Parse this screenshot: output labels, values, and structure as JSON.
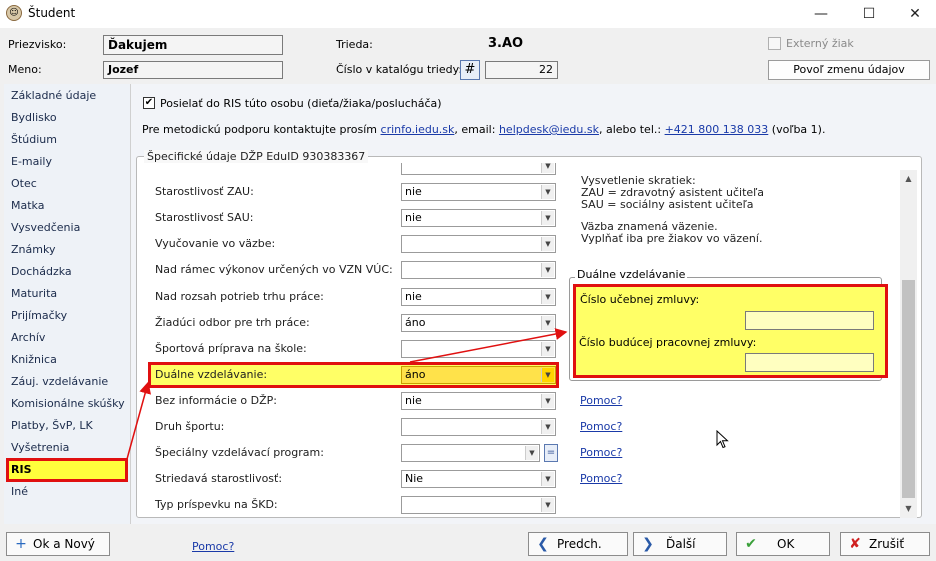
{
  "window": {
    "title": "Študent",
    "controls": [
      "minimize-icon",
      "maximize-icon",
      "close-icon"
    ]
  },
  "header": {
    "surname_label": "Priezvisko:",
    "surname_value": "Ďakujem",
    "name_label": "Meno:",
    "name_value": "Jozef",
    "class_label": "Trieda:",
    "class_value": "3.AO",
    "catalog_label": "Číslo v katalógu triedy:",
    "catalog_hash": "#",
    "catalog_value": "22",
    "external_label": "Externý žiak",
    "allow_change_button": "Povoľ zmenu údajov"
  },
  "sidebar": {
    "items": [
      {
        "label": "Základné údaje"
      },
      {
        "label": "Bydlisko"
      },
      {
        "label": "Štúdium"
      },
      {
        "label": "E-maily"
      },
      {
        "label": "Otec"
      },
      {
        "label": "Matka"
      },
      {
        "label": "Vysvedčenia"
      },
      {
        "label": "Známky"
      },
      {
        "label": "Dochádzka"
      },
      {
        "label": "Maturita"
      },
      {
        "label": "Prijímačky"
      },
      {
        "label": "Archív"
      },
      {
        "label": "Knižnica"
      },
      {
        "label": "Záuj. vzdelávanie"
      },
      {
        "label": "Komisionálne skúšky"
      },
      {
        "label": "Platby, ŠvP, LK"
      },
      {
        "label": "Vyšetrenia"
      },
      {
        "label": "RIS"
      },
      {
        "label": "Iné"
      }
    ]
  },
  "main": {
    "send_to_ris_label": "Posielať do RIS túto osobu (dieťa/žiaka/poslucháča)",
    "support_text_1": "Pre metodickú podporu kontaktujte prosím",
    "support_link_1": "crinfo.iedu.sk",
    "support_text_2": ", email:",
    "support_link_2": "helpdesk@iedu.sk",
    "support_text_3": ", alebo tel.:",
    "support_link_3": "+421 800 138 033",
    "support_text_4": "(voľba 1).",
    "group_title": "Špecifické údaje DŽP EduID 930383367",
    "fields": [
      {
        "label": "Starostlivosť ZAU:",
        "value": "nie"
      },
      {
        "label": "Starostlivosť SAU:",
        "value": "nie"
      },
      {
        "label": "Vyučovanie vo väzbe:",
        "value": ""
      },
      {
        "label": "Nad rámec výkonov určených vo VZN VÚC:",
        "value": ""
      },
      {
        "label": "Nad rozsah potrieb trhu práce:",
        "value": "nie"
      },
      {
        "label": "Žiadúci odbor pre trh práce:",
        "value": "áno"
      },
      {
        "label": "Športová príprava na škole:",
        "value": ""
      },
      {
        "label": "Duálne vzdelávanie:",
        "value": "áno"
      },
      {
        "label": "Bez informácie o DŽP:",
        "value": "nie"
      },
      {
        "label": "Druh športu:",
        "value": ""
      },
      {
        "label": "Špeciálny vzdelávací program:",
        "value": ""
      },
      {
        "label": "Striedavá starostlivosť:",
        "value": "Nie"
      },
      {
        "label": "Typ príspevku na ŠKD:",
        "value": ""
      }
    ],
    "help_link": "Pomoc?",
    "notes": {
      "line1": "Vysvetlenie skratiek:",
      "line2": "ZAU = zdravotný asistent učiteľa",
      "line3": "SAU = sociálny asistent učiteľa",
      "line4": "Väzba znamená väzenie.",
      "line5": "Vyplňať iba pre žiakov vo väzení."
    },
    "dual_group": {
      "title": "Duálne vzdelávanie",
      "contract_label": "Číslo učebnej zmluvy:",
      "contract_value": "",
      "future_label": "Číslo budúcej pracovnej zmluvy:",
      "future_value": ""
    }
  },
  "footer": {
    "ok_new": "Ok a Nový",
    "help": "Pomoc?",
    "prev": "Predch.",
    "next": "Ďalší",
    "ok": "OK",
    "cancel": "Zrušiť"
  },
  "colors": {
    "highlight_yellow": "#ffff66",
    "annotation_red": "#e01010",
    "link_blue": "#1a3aa8"
  }
}
